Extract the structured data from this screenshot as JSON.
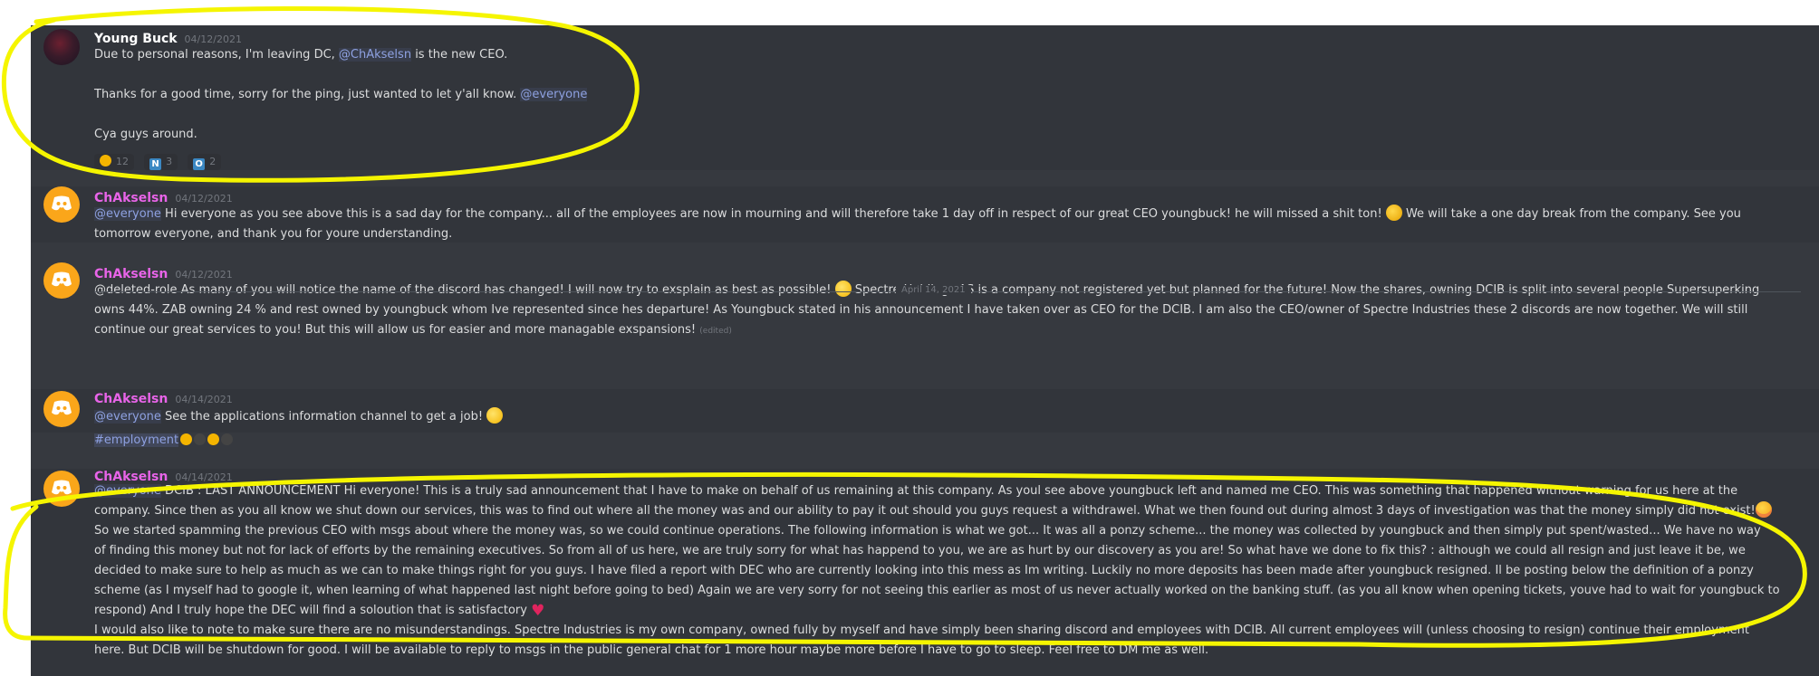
{
  "messages": [
    {
      "author": "Young Buck",
      "timestamp": "04/12/2021",
      "lines": {
        "l1_pre": "Due to personal reasons, I'm leaving DC, ",
        "l1_mention": "@ChAkselsn",
        "l1_post": " is the new CEO.",
        "l2_pre": "Thanks for a good time, sorry for the ping, just wanted to let y'all know. ",
        "l2_mention": "@everyone",
        "l3": "Cya guys around."
      },
      "reactions": [
        {
          "icon": "crying-face",
          "count": "12"
        },
        {
          "icon": "letter-n",
          "glyph": "N",
          "count": "3"
        },
        {
          "icon": "letter-o",
          "glyph": "O",
          "count": "2"
        }
      ]
    },
    {
      "author": "ChAkselsn",
      "timestamp": "04/12/2021",
      "mention": "@everyone",
      "l1a": " Hi everyone as you see above this is a sad day for the company... all of the employees are now in mourning and will therefore take 1 day off in respect of our great CEO youngbuck! he will missed a shit ton! ",
      "l1b": "  We will take a one day break from the company. See you",
      "l2": "tomorrow everyone, and thank you for youre understanding."
    },
    {
      "author": "ChAkselsn",
      "timestamp": "04/12/2021",
      "l1a": "@deleted-role   As many of you will notice the name of the discord has changed! I will now try to exsplain as best as possible! ",
      "l1b": " Spectre Holdings AS is a company not registered yet but planned for the future! Now the shares, owning DCIB is split into several people Supersuperking",
      "l2": "owns 44%. ZAB owning 24 % and rest owned by youngbuck whom Ive represented since hes departure! As Youngbuck stated in his announcement I have taken over as CEO for the DCIB. I am also the CEO/owner of Spectre Industries these 2 discords are now together. We will still",
      "l3": "continue our great services to you! But this will allow us for easier and more managable exspansions! ",
      "edited": "(edited)"
    },
    {
      "author": "ChAkselsn",
      "timestamp": "04/14/2021",
      "mention": "@everyone",
      "l1": "  See the applications information channel to get a job! ",
      "channel": "#employment"
    },
    {
      "author": "ChAkselsn",
      "timestamp": "04/14/2021",
      "mention": "@everyone",
      "lines": [
        "  DCIB : LAST ANNOUNCEMENT Hi everyone! This is a truly sad announcement that I have to make on behalf of us remaining at this company. As youl see above youngbuck left and named me CEO. This was something that happened without warning for us here at the",
        "company. Since then as you all know we shut down our services, this was to find out where all the money was and our ability to pay it out should you guys request a withdrawel. What we then found out during almost 3 days of investigation was that the money simply did not exist!",
        " So we started spamming the previous CEO with msgs about where the money was, so we could continue operations. The following information is what we got... It was all a ponzy scheme... the money was collected by youngbuck and then simply put spent/wasted... We have no way",
        "of finding this money but not for lack of efforts by the remaining executives. So from all of us here, we are truly sorry for what has happend to you, we are as hurt by our discovery as you are! So what have we done to fix this? : although we could all resign and just leave it be, we",
        "decided to make sure to help as much as we can to make things right for you guys. I have filed a report with DEC who are currently looking into this mess as Im writing. Luckily no more deposits has been made after youngbuck resigned. Il be posting below the definition of a ponzy",
        "scheme (as I myself had to google it, when learning of what happened last night before going to bed) Again we are very sorry for not seeing this earlier as most of us never actually worked on the banking stuff. (as you all know when opening tickets, youve had to wait for youngbuck to",
        "respond) And I truly hope the DEC will find a soloution that is satisfactory ",
        "I would also like to note to make sure there are no misunderstandings. Spectre Industries is my own company, owned fully by myself and have simply been sharing discord and employees with DCIB. All current employees will (unless choosing to resign) continue their employment",
        "here. But DCIB will be shutdown for good. I will be available to reply to msgs in the public general chat for 1 more hour maybe more before I have to go to sleep. Feel free to DM me as well."
      ]
    }
  ],
  "divider": "April 14, 2021",
  "colors": {
    "background": "#36393f",
    "mention": "#8ea1e1",
    "username_admin": "#e864e8",
    "annotation": "#f5f500"
  }
}
